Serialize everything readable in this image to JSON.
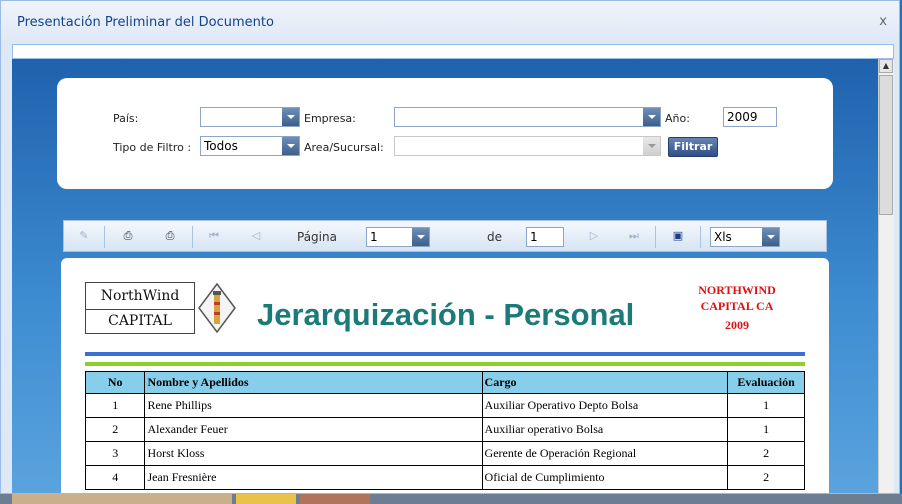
{
  "dialog": {
    "title": "Presentación Preliminar del Documento",
    "close_glyph": "x"
  },
  "filters": {
    "pais_label": "País:",
    "empresa_label": "Empresa:",
    "anio_label": "Año:",
    "anio_value": "2009",
    "tipo_label": "Tipo de Filtro :",
    "tipo_value": "Todos",
    "area_label": "Area/Sucursal:",
    "filtrar_label": "Filtrar"
  },
  "toolbar": {
    "pagina_label": "Página",
    "page_value": "1",
    "de_label": "de",
    "total_pages": "1",
    "format_value": "Xls",
    "icons": [
      "edit-icon",
      "print-icon",
      "print-preview-icon",
      "first-page-icon",
      "prev-page-icon",
      "next-page-icon",
      "last-page-icon",
      "save-icon"
    ]
  },
  "report": {
    "logo_top": "NorthWind",
    "logo_bottom": "CAPITAL",
    "title": "Jerarquización - Personal",
    "company_line1": "NORTHWIND",
    "company_line2": "CAPITAL CA",
    "year": "2009",
    "columns": [
      "No",
      "Nombre y Apellidos",
      "Cargo",
      "Evaluación"
    ],
    "rows": [
      [
        "1",
        "Rene Phillips",
        "Auxiliar Operativo Depto Bolsa",
        "1"
      ],
      [
        "2",
        "Alexander Feuer",
        "Auxiliar operativo Bolsa",
        "1"
      ],
      [
        "3",
        "Horst Kloss",
        "Gerente de Operación Regional",
        "2"
      ],
      [
        "4",
        "Jean Fresnière",
        "Oficial de Cumplimiento",
        "2"
      ]
    ]
  },
  "colors": {
    "accent": "#15428b",
    "title_teal": "#1a7b78",
    "company_red": "#e01010",
    "header_blue": "#87ceeb"
  }
}
